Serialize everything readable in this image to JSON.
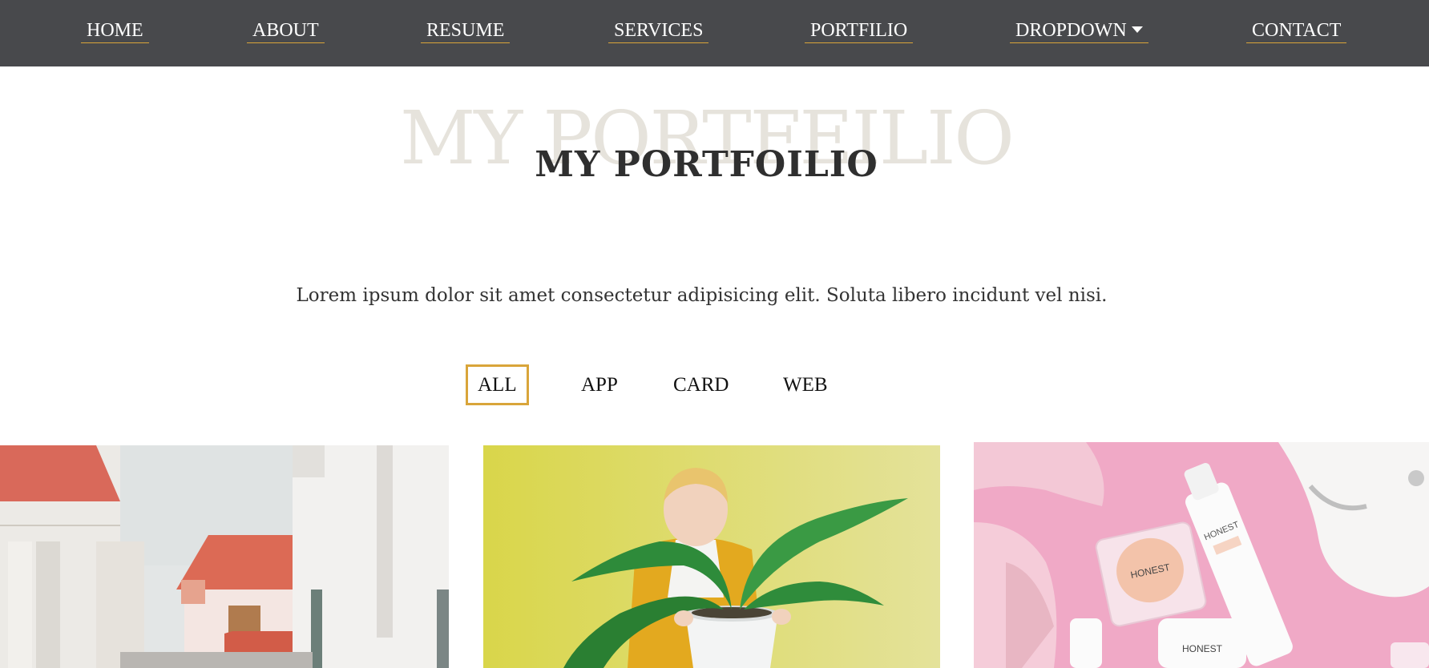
{
  "nav": {
    "items": [
      {
        "label": "HOME"
      },
      {
        "label": "ABOUT"
      },
      {
        "label": "RESUME"
      },
      {
        "label": "SERVICES"
      },
      {
        "label": "PORTFILIO"
      },
      {
        "label": "DROPDOWN"
      },
      {
        "label": "CONTACT"
      }
    ],
    "dropdown_icon": "caret-down-icon",
    "background_color": "#48494c",
    "underline_color": "#d9a53a"
  },
  "section": {
    "background_title": "MY PORTFEILIO",
    "title": "MY PORTFOILIO",
    "subtitle": "Lorem ipsum dolor sit amet consectetur adipisicing elit. Soluta libero incidunt vel nisi."
  },
  "filters": {
    "items": [
      {
        "label": "ALL",
        "active": true
      },
      {
        "label": "APP",
        "active": false
      },
      {
        "label": "CARD",
        "active": false
      },
      {
        "label": "WEB",
        "active": false
      }
    ],
    "active_border_color": "#d9a53a"
  },
  "portfolio": {
    "images": [
      {
        "subject": "white houses with red roofs street photo"
      },
      {
        "subject": "child in yellow jacket holding a potted plant on yellow background"
      },
      {
        "subject": "pink flat-lay of cosmetics and accessories",
        "brand_text": "HONEST"
      }
    ]
  }
}
